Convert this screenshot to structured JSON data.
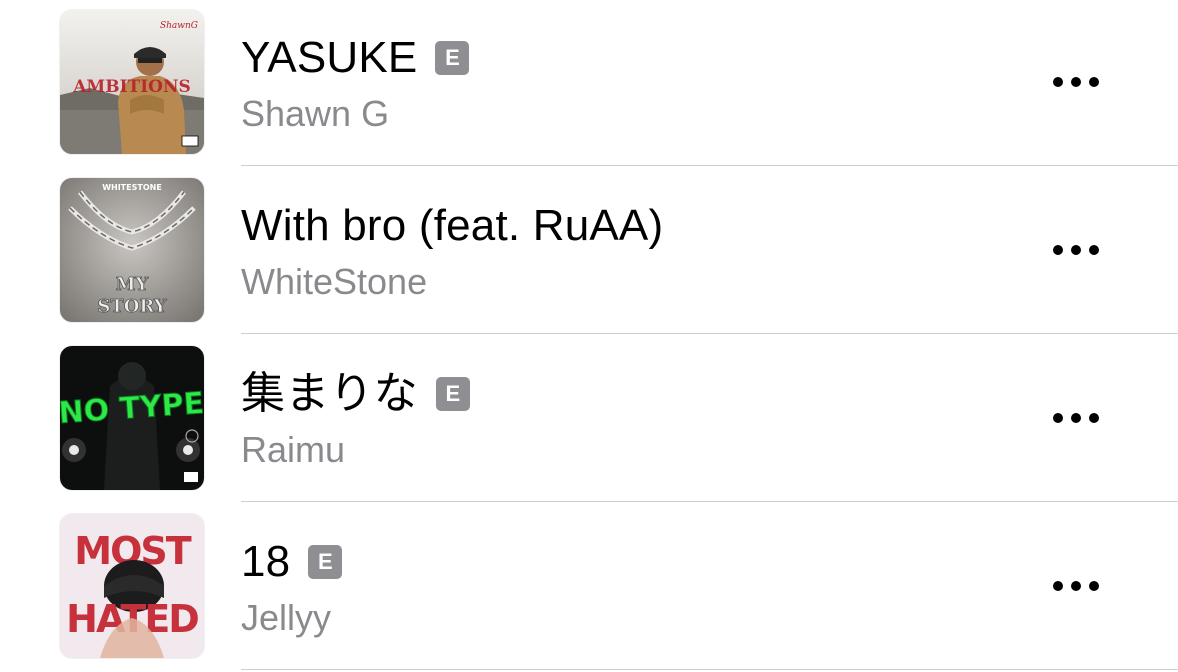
{
  "tracks": [
    {
      "title": "YASUKE",
      "explicit": true,
      "explicit_label": "E",
      "artist": "Shawn G",
      "artwork_icon": "album-art-yasuke",
      "artwork_text": "AMBITIONS"
    },
    {
      "title": "With bro (feat. RuAA)",
      "explicit": false,
      "explicit_label": "",
      "artist": "WhiteStone",
      "artwork_icon": "album-art-my-story",
      "artwork_text": "MY STORY"
    },
    {
      "title": "集まりな",
      "explicit": true,
      "explicit_label": "E",
      "artist": "Raimu",
      "artwork_icon": "album-art-no-type",
      "artwork_text": "NO TYPE"
    },
    {
      "title": "18",
      "explicit": true,
      "explicit_label": "E",
      "artist": "Jellyy",
      "artwork_icon": "album-art-most-hated",
      "artwork_text": "MOST HATED"
    }
  ],
  "more_icon": "ellipsis-icon",
  "colors": {
    "secondary_text": "#8a8a8e",
    "badge": "#8e8e93",
    "separator": "#cfcfd2"
  }
}
